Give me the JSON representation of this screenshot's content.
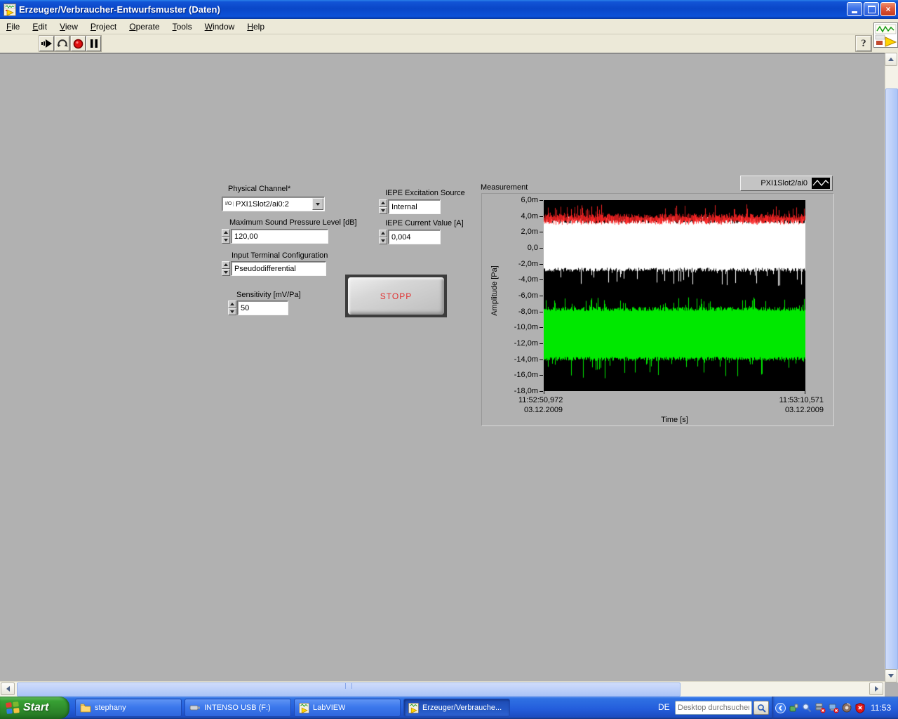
{
  "window": {
    "title": "Erzeuger/Verbraucher-Entwurfsmuster (Daten)"
  },
  "menu": {
    "items": [
      {
        "label": "File"
      },
      {
        "label": "Edit"
      },
      {
        "label": "View"
      },
      {
        "label": "Project"
      },
      {
        "label": "Operate"
      },
      {
        "label": "Tools"
      },
      {
        "label": "Window"
      },
      {
        "label": "Help"
      }
    ]
  },
  "toolbar": {
    "icons": [
      "run",
      "run-continuous",
      "abort",
      "pause"
    ],
    "help_label": "?"
  },
  "controls": {
    "physical_channel": {
      "label": "Physical Channel*",
      "value": "PXI1Slot2/ai0:2",
      "io_glyph": "I/O"
    },
    "max_sound_pressure": {
      "label": "Maximum Sound Pressure Level [dB]",
      "value": "120,00"
    },
    "input_terminal": {
      "label": "Input Terminal Configuration",
      "value": "Pseudodifferential"
    },
    "sensitivity": {
      "label": "Sensitivity [mV/Pa]",
      "value": "50"
    },
    "iepe_source": {
      "label": "IEPE Excitation Source",
      "value": "Internal"
    },
    "iepe_current": {
      "label": "IEPE Current Value [A]",
      "value": "0,004"
    },
    "stop": {
      "label": "STOPP",
      "text_color": "#e03030"
    }
  },
  "chart_data": {
    "type": "line",
    "title": "Measurement",
    "legend": [
      "PXI1Slot2/ai0"
    ],
    "xlabel": "Time [s]",
    "ylabel": "Amplitude [Pa]",
    "x_axis": {
      "start_time": "11:52:50,972",
      "start_date": "03.12.2009",
      "end_time": "11:53:10,571",
      "end_date": "03.12.2009"
    },
    "y_ticks": [
      "6,0m",
      "4,0m",
      "2,0m",
      "0,0",
      "-2,0m",
      "-4,0m",
      "-6,0m",
      "-8,0m",
      "-10,0m",
      "-12,0m",
      "-14,0m",
      "-16,0m",
      "-18,0m"
    ],
    "y_tick_values_mPa": [
      6,
      4,
      2,
      0,
      -2,
      -4,
      -6,
      -8,
      -10,
      -12,
      -14,
      -16,
      -18
    ],
    "ylim_pa": [
      -0.018,
      0.006
    ],
    "grid": false,
    "plot_bg": "#000000",
    "series": [
      {
        "name": "red noise band",
        "color": "#ff2525",
        "band_mPa": {
          "core_min": 3.0,
          "core_max": 4.3,
          "peak_min": 2.9,
          "peak_max": 5.5
        }
      },
      {
        "name": "white noise band",
        "color": "#ffffff",
        "band_mPa": {
          "core_min": -3.0,
          "core_max": 3.6,
          "peak_min": -4.8,
          "peak_max": 4.0
        }
      },
      {
        "name": "green noise band",
        "color": "#00e800",
        "band_mPa": {
          "core_min": -14.2,
          "core_max": -7.4,
          "peak_min": -16.4,
          "peak_max": -6.2
        }
      }
    ]
  },
  "taskbar": {
    "start_label": "Start",
    "tasks": [
      {
        "label": "stephany",
        "icon": "folder-icon"
      },
      {
        "label": "INTENSO USB (F:)",
        "icon": "usb-drive-icon"
      },
      {
        "label": "LabVIEW",
        "icon": "labview-icon"
      },
      {
        "label": "Erzeuger/Verbrauche...",
        "icon": "labview-icon"
      }
    ],
    "language_indicator": "DE",
    "search_placeholder": "Desktop durchsuchen",
    "clock": "11:53"
  }
}
